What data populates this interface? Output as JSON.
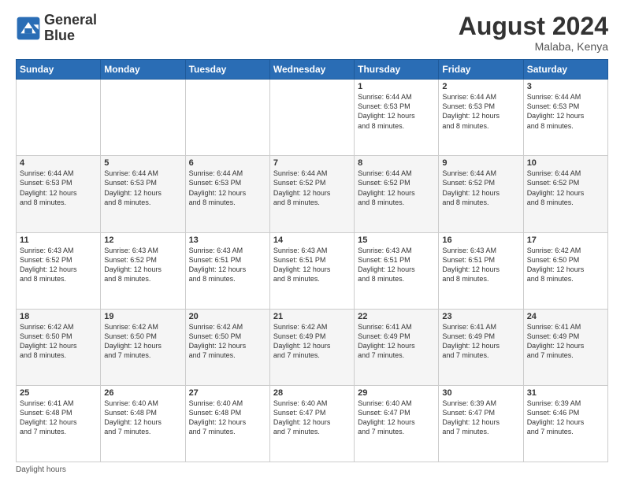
{
  "header": {
    "logo_line1": "General",
    "logo_line2": "Blue",
    "month_title": "August 2024",
    "location": "Malaba, Kenya"
  },
  "days_of_week": [
    "Sunday",
    "Monday",
    "Tuesday",
    "Wednesday",
    "Thursday",
    "Friday",
    "Saturday"
  ],
  "footer": {
    "daylight_hours": "Daylight hours"
  },
  "weeks": [
    [
      {
        "num": "",
        "info": ""
      },
      {
        "num": "",
        "info": ""
      },
      {
        "num": "",
        "info": ""
      },
      {
        "num": "",
        "info": ""
      },
      {
        "num": "1",
        "info": "Sunrise: 6:44 AM\nSunset: 6:53 PM\nDaylight: 12 hours\nand 8 minutes."
      },
      {
        "num": "2",
        "info": "Sunrise: 6:44 AM\nSunset: 6:53 PM\nDaylight: 12 hours\nand 8 minutes."
      },
      {
        "num": "3",
        "info": "Sunrise: 6:44 AM\nSunset: 6:53 PM\nDaylight: 12 hours\nand 8 minutes."
      }
    ],
    [
      {
        "num": "4",
        "info": "Sunrise: 6:44 AM\nSunset: 6:53 PM\nDaylight: 12 hours\nand 8 minutes."
      },
      {
        "num": "5",
        "info": "Sunrise: 6:44 AM\nSunset: 6:53 PM\nDaylight: 12 hours\nand 8 minutes."
      },
      {
        "num": "6",
        "info": "Sunrise: 6:44 AM\nSunset: 6:53 PM\nDaylight: 12 hours\nand 8 minutes."
      },
      {
        "num": "7",
        "info": "Sunrise: 6:44 AM\nSunset: 6:52 PM\nDaylight: 12 hours\nand 8 minutes."
      },
      {
        "num": "8",
        "info": "Sunrise: 6:44 AM\nSunset: 6:52 PM\nDaylight: 12 hours\nand 8 minutes."
      },
      {
        "num": "9",
        "info": "Sunrise: 6:44 AM\nSunset: 6:52 PM\nDaylight: 12 hours\nand 8 minutes."
      },
      {
        "num": "10",
        "info": "Sunrise: 6:44 AM\nSunset: 6:52 PM\nDaylight: 12 hours\nand 8 minutes."
      }
    ],
    [
      {
        "num": "11",
        "info": "Sunrise: 6:43 AM\nSunset: 6:52 PM\nDaylight: 12 hours\nand 8 minutes."
      },
      {
        "num": "12",
        "info": "Sunrise: 6:43 AM\nSunset: 6:52 PM\nDaylight: 12 hours\nand 8 minutes."
      },
      {
        "num": "13",
        "info": "Sunrise: 6:43 AM\nSunset: 6:51 PM\nDaylight: 12 hours\nand 8 minutes."
      },
      {
        "num": "14",
        "info": "Sunrise: 6:43 AM\nSunset: 6:51 PM\nDaylight: 12 hours\nand 8 minutes."
      },
      {
        "num": "15",
        "info": "Sunrise: 6:43 AM\nSunset: 6:51 PM\nDaylight: 12 hours\nand 8 minutes."
      },
      {
        "num": "16",
        "info": "Sunrise: 6:43 AM\nSunset: 6:51 PM\nDaylight: 12 hours\nand 8 minutes."
      },
      {
        "num": "17",
        "info": "Sunrise: 6:42 AM\nSunset: 6:50 PM\nDaylight: 12 hours\nand 8 minutes."
      }
    ],
    [
      {
        "num": "18",
        "info": "Sunrise: 6:42 AM\nSunset: 6:50 PM\nDaylight: 12 hours\nand 8 minutes."
      },
      {
        "num": "19",
        "info": "Sunrise: 6:42 AM\nSunset: 6:50 PM\nDaylight: 12 hours\nand 7 minutes."
      },
      {
        "num": "20",
        "info": "Sunrise: 6:42 AM\nSunset: 6:50 PM\nDaylight: 12 hours\nand 7 minutes."
      },
      {
        "num": "21",
        "info": "Sunrise: 6:42 AM\nSunset: 6:49 PM\nDaylight: 12 hours\nand 7 minutes."
      },
      {
        "num": "22",
        "info": "Sunrise: 6:41 AM\nSunset: 6:49 PM\nDaylight: 12 hours\nand 7 minutes."
      },
      {
        "num": "23",
        "info": "Sunrise: 6:41 AM\nSunset: 6:49 PM\nDaylight: 12 hours\nand 7 minutes."
      },
      {
        "num": "24",
        "info": "Sunrise: 6:41 AM\nSunset: 6:49 PM\nDaylight: 12 hours\nand 7 minutes."
      }
    ],
    [
      {
        "num": "25",
        "info": "Sunrise: 6:41 AM\nSunset: 6:48 PM\nDaylight: 12 hours\nand 7 minutes."
      },
      {
        "num": "26",
        "info": "Sunrise: 6:40 AM\nSunset: 6:48 PM\nDaylight: 12 hours\nand 7 minutes."
      },
      {
        "num": "27",
        "info": "Sunrise: 6:40 AM\nSunset: 6:48 PM\nDaylight: 12 hours\nand 7 minutes."
      },
      {
        "num": "28",
        "info": "Sunrise: 6:40 AM\nSunset: 6:47 PM\nDaylight: 12 hours\nand 7 minutes."
      },
      {
        "num": "29",
        "info": "Sunrise: 6:40 AM\nSunset: 6:47 PM\nDaylight: 12 hours\nand 7 minutes."
      },
      {
        "num": "30",
        "info": "Sunrise: 6:39 AM\nSunset: 6:47 PM\nDaylight: 12 hours\nand 7 minutes."
      },
      {
        "num": "31",
        "info": "Sunrise: 6:39 AM\nSunset: 6:46 PM\nDaylight: 12 hours\nand 7 minutes."
      }
    ]
  ]
}
